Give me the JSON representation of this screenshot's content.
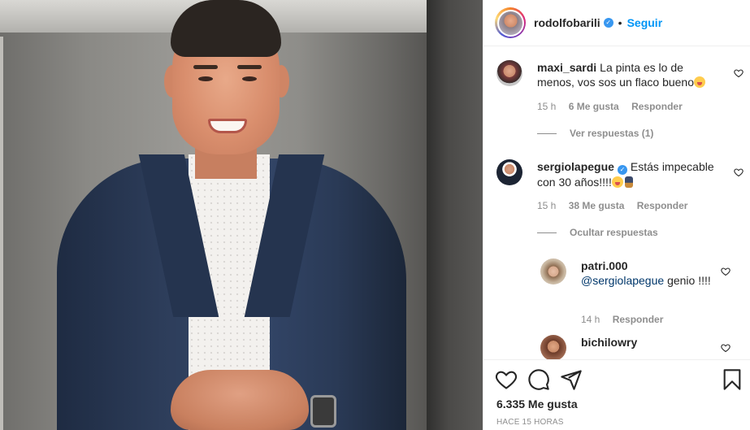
{
  "post": {
    "author": {
      "username": "rodolfobarili",
      "verified": true,
      "separator": "•",
      "follow_label": "Seguir"
    },
    "comments": [
      {
        "username": "maxi_sardi",
        "text": "La pinta es lo de menos, vos sos un flaco bueno",
        "emoji": "face-with-tongue",
        "time": "15 h",
        "likes": "6 Me gusta",
        "reply_label": "Responder",
        "replies_toggle": "Ver respuestas (1)"
      },
      {
        "username": "sergiolapegue",
        "verified": true,
        "text": "Estás impecable con 30 años!!!!",
        "emoji": "face-with-tongue, man-in-suit",
        "time": "15 h",
        "likes": "38 Me gusta",
        "reply_label": "Responder",
        "replies_toggle": "Ocultar respuestas",
        "replies": [
          {
            "username": "patri.000",
            "mention": "@sergiolapegue",
            "text": "genio !!!!",
            "time": "14 h",
            "reply_label": "Responder"
          },
          {
            "username": "bichilowry"
          }
        ]
      }
    ],
    "actions": {
      "like_icon": "heart-icon",
      "comment_icon": "comment-bubble-icon",
      "share_icon": "paper-plane-icon",
      "save_icon": "bookmark-icon",
      "likes_count": "6.335 Me gusta",
      "timestamp": "HACE 15 HORAS"
    },
    "colors": {
      "link_blue": "#0095f6",
      "verified_blue": "#3897f0",
      "secondary_text": "#8e8e8e",
      "primary_text": "#262626"
    }
  }
}
